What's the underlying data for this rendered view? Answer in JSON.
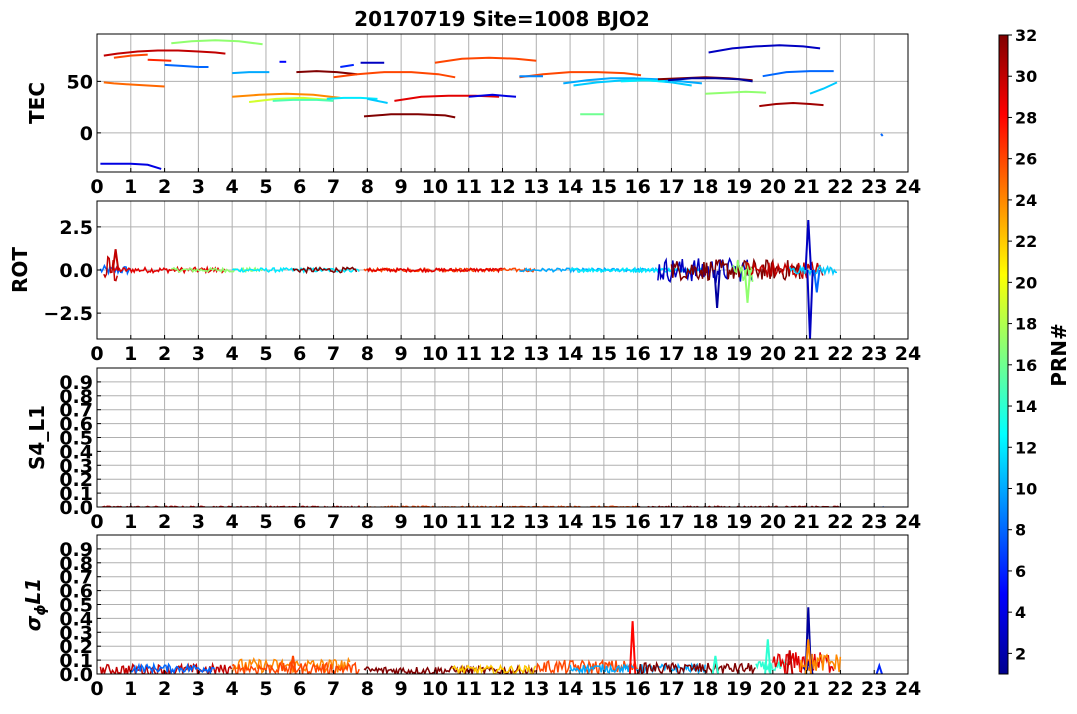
{
  "figure": {
    "title": "20170719 Site=1008 BJO2",
    "colorbar_label": "PRN#",
    "colorbar_range": [
      1,
      32
    ],
    "colorbar_ticks": [
      "2",
      "4",
      "6",
      "8",
      "10",
      "12",
      "14",
      "16",
      "18",
      "20",
      "22",
      "24",
      "26",
      "28",
      "30",
      "32"
    ],
    "colormap": "jet"
  },
  "chart_data": [
    {
      "type": "line",
      "ylabel": "TEC",
      "xlim": [
        0,
        24
      ],
      "ylim": [
        -38,
        96
      ],
      "x_ticks": [
        "0",
        "1",
        "2",
        "3",
        "4",
        "5",
        "6",
        "7",
        "8",
        "9",
        "10",
        "11",
        "12",
        "13",
        "14",
        "15",
        "16",
        "17",
        "18",
        "19",
        "20",
        "21",
        "22",
        "23",
        "24"
      ],
      "y_ticks": [
        {
          "v": 0,
          "label": "0"
        },
        {
          "v": 50,
          "label": "50"
        }
      ],
      "grid": true,
      "series": [
        {
          "prn": 25,
          "x": [
            0.2,
            0.5,
            1.0,
            1.5,
            2.0
          ],
          "y": [
            49,
            48,
            47,
            46,
            45
          ]
        },
        {
          "prn": 4,
          "x": [
            0.1,
            0.5,
            1.0,
            1.5,
            1.9
          ],
          "y": [
            -30,
            -30,
            -30,
            -31,
            -35
          ]
        },
        {
          "prn": 30,
          "x": [
            0.2,
            0.6,
            1.2,
            1.8,
            2.4,
            3.0,
            3.5,
            3.8
          ],
          "y": [
            75,
            77,
            79,
            80,
            80,
            79,
            78,
            77
          ]
        },
        {
          "prn": 26,
          "x": [
            0.5,
            1.0,
            1.5
          ],
          "y": [
            73,
            75,
            76
          ]
        },
        {
          "prn": 27,
          "x": [
            1.5,
            2.2
          ],
          "y": [
            71,
            70
          ]
        },
        {
          "prn": 8,
          "x": [
            2.0,
            2.5,
            3.0,
            3.3
          ],
          "y": [
            66,
            65,
            64,
            64
          ]
        },
        {
          "prn": 17,
          "x": [
            2.2,
            2.8,
            3.5,
            4.2,
            4.9
          ],
          "y": [
            87,
            89,
            90,
            89,
            86
          ]
        },
        {
          "prn": 10,
          "x": [
            4.0,
            4.5,
            5.1
          ],
          "y": [
            58,
            59,
            59
          ]
        },
        {
          "prn": 5,
          "x": [
            5.4,
            5.6
          ],
          "y": [
            69,
            69
          ]
        },
        {
          "prn": 24,
          "x": [
            4.0,
            4.8,
            5.6,
            6.4,
            7.2
          ],
          "y": [
            35,
            37,
            38,
            37,
            34
          ]
        },
        {
          "prn": 19,
          "x": [
            4.5,
            5.3,
            6.1,
            6.9
          ],
          "y": [
            30,
            33,
            34,
            32
          ]
        },
        {
          "prn": 15,
          "x": [
            5.2,
            5.8,
            6.5,
            7.0
          ],
          "y": [
            31,
            32,
            32,
            31
          ]
        },
        {
          "prn": 32,
          "x": [
            5.9,
            6.5,
            7.1,
            7.7
          ],
          "y": [
            59,
            60,
            59,
            57
          ]
        },
        {
          "prn": 6,
          "x": [
            7.2,
            7.6
          ],
          "y": [
            64,
            66
          ]
        },
        {
          "prn": 3,
          "x": [
            7.8,
            8.5
          ],
          "y": [
            68,
            68
          ]
        },
        {
          "prn": 12,
          "x": [
            6.8,
            7.3,
            7.8,
            8.3
          ],
          "y": [
            33,
            34,
            34,
            33
          ]
        },
        {
          "prn": 11,
          "x": [
            8.0,
            8.6
          ],
          "y": [
            33,
            29
          ]
        },
        {
          "prn": 26,
          "x": [
            7.0,
            7.7,
            8.5,
            9.3,
            10.1,
            10.6
          ],
          "y": [
            54,
            57,
            59,
            59,
            57,
            54
          ]
        },
        {
          "prn": 32,
          "x": [
            7.9,
            8.7,
            9.5,
            10.3,
            10.6
          ],
          "y": [
            16,
            18,
            18,
            17,
            15
          ]
        },
        {
          "prn": 29,
          "x": [
            8.8,
            9.6,
            10.4,
            11.2,
            11.9
          ],
          "y": [
            31,
            35,
            36,
            36,
            35
          ]
        },
        {
          "prn": 4,
          "x": [
            11.0,
            11.7,
            12.4
          ],
          "y": [
            35,
            37,
            35
          ]
        },
        {
          "prn": 26,
          "x": [
            10.0,
            10.8,
            11.6,
            12.4,
            13.0
          ],
          "y": [
            68,
            72,
            73,
            72,
            70
          ]
        },
        {
          "prn": 26,
          "x": [
            12.5,
            13.2,
            14.0,
            14.8,
            15.6,
            16.1
          ],
          "y": [
            54,
            57,
            59,
            59,
            58,
            56
          ]
        },
        {
          "prn": 9,
          "x": [
            12.5,
            13.2
          ],
          "y": [
            55,
            55
          ]
        },
        {
          "prn": 10,
          "x": [
            13.8,
            14.5,
            15.2,
            15.9,
            16.6,
            17.3,
            17.9
          ],
          "y": [
            48,
            51,
            53,
            53,
            52,
            50,
            48
          ]
        },
        {
          "prn": 11,
          "x": [
            14.1,
            14.8,
            15.6,
            16.3,
            17.0,
            17.6
          ],
          "y": [
            46,
            49,
            51,
            51,
            49,
            46
          ]
        },
        {
          "prn": 16,
          "x": [
            14.3,
            15.0
          ],
          "y": [
            18,
            18
          ]
        },
        {
          "prn": 12,
          "x": [
            15.5,
            16.2,
            16.8
          ],
          "y": [
            50,
            51,
            50
          ]
        },
        {
          "prn": 32,
          "x": [
            16.6,
            17.3,
            18.0,
            18.7,
            19.4
          ],
          "y": [
            52,
            53,
            54,
            53,
            51
          ]
        },
        {
          "prn": 2,
          "x": [
            16.9,
            17.6,
            18.3,
            19.0,
            19.4
          ],
          "y": [
            51,
            53,
            53,
            52,
            50
          ]
        },
        {
          "prn": 17,
          "x": [
            18.0,
            18.6,
            19.2,
            19.8
          ],
          "y": [
            38,
            39,
            40,
            39
          ]
        },
        {
          "prn": 3,
          "x": [
            18.1,
            18.8,
            19.5,
            20.2,
            20.9,
            21.4
          ],
          "y": [
            78,
            82,
            84,
            85,
            84,
            82
          ]
        },
        {
          "prn": 31,
          "x": [
            19.6,
            20.1,
            20.6,
            21.1,
            21.5
          ],
          "y": [
            26,
            28,
            29,
            28,
            27
          ]
        },
        {
          "prn": 8,
          "x": [
            19.7,
            20.4,
            21.1,
            21.8
          ],
          "y": [
            55,
            59,
            60,
            60
          ]
        },
        {
          "prn": 11,
          "x": [
            21.1,
            21.5,
            21.9
          ],
          "y": [
            38,
            43,
            49
          ]
        },
        {
          "prn": 8,
          "x": [
            23.2,
            23.25
          ],
          "y": [
            -1,
            -3
          ]
        }
      ]
    },
    {
      "type": "line",
      "ylabel": "ROT",
      "xlim": [
        0,
        24
      ],
      "ylim": [
        -4.0,
        4.0
      ],
      "x_ticks": [
        "0",
        "1",
        "2",
        "3",
        "4",
        "5",
        "6",
        "7",
        "8",
        "9",
        "10",
        "11",
        "12",
        "13",
        "14",
        "15",
        "16",
        "17",
        "18",
        "19",
        "20",
        "21",
        "22",
        "23",
        "24"
      ],
      "y_ticks": [
        {
          "v": -2.5,
          "label": "−2.5"
        },
        {
          "v": 0,
          "label": "0.0"
        },
        {
          "v": 2.5,
          "label": "2.5"
        }
      ],
      "grid": true,
      "noise": [
        {
          "prn": 8,
          "x0": 0.1,
          "x1": 1.0,
          "amp": 0.25
        },
        {
          "prn": 30,
          "x0": 0.2,
          "x1": 0.6,
          "amp": 0.9
        },
        {
          "prn": 29,
          "x0": 0.5,
          "x1": 3.8,
          "amp": 0.15
        },
        {
          "prn": 17,
          "x0": 2.2,
          "x1": 4.9,
          "amp": 0.12
        },
        {
          "prn": 12,
          "x0": 4.0,
          "x1": 7.8,
          "amp": 0.12
        },
        {
          "prn": 32,
          "x0": 5.8,
          "x1": 7.7,
          "amp": 0.15
        },
        {
          "prn": 26,
          "x0": 7.9,
          "x1": 13.0,
          "amp": 0.1
        },
        {
          "prn": 29,
          "x0": 8.0,
          "x1": 12.0,
          "amp": 0.1
        },
        {
          "prn": 10,
          "x0": 12.5,
          "x1": 17.9,
          "amp": 0.1
        },
        {
          "prn": 12,
          "x0": 14.0,
          "x1": 18.0,
          "amp": 0.12
        },
        {
          "prn": 3,
          "x0": 16.6,
          "x1": 19.4,
          "amp": 0.7
        },
        {
          "prn": 32,
          "x0": 17.0,
          "x1": 20.8,
          "amp": 0.6
        },
        {
          "prn": 17,
          "x0": 18.8,
          "x1": 19.4,
          "amp": 0.7
        },
        {
          "prn": 30,
          "x0": 19.2,
          "x1": 21.5,
          "amp": 0.5
        },
        {
          "prn": 11,
          "x0": 20.5,
          "x1": 21.9,
          "amp": 0.25
        }
      ],
      "spikes": [
        {
          "prn": 30,
          "x": 0.55,
          "y": 1.2
        },
        {
          "prn": 2,
          "x": 18.35,
          "y": -2.2
        },
        {
          "prn": 17,
          "x": 19.25,
          "y": -1.9
        },
        {
          "prn": 3,
          "x": 21.05,
          "y": 2.9
        },
        {
          "prn": 3,
          "x": 21.1,
          "y": -4.0
        },
        {
          "prn": 8,
          "x": 21.3,
          "y": -1.3
        }
      ]
    },
    {
      "type": "line",
      "ylabel": "S4_L1",
      "xlim": [
        0,
        24
      ],
      "ylim": [
        0.0,
        1.0
      ],
      "x_ticks": [
        "0",
        "1",
        "2",
        "3",
        "4",
        "5",
        "6",
        "7",
        "8",
        "9",
        "10",
        "11",
        "12",
        "13",
        "14",
        "15",
        "16",
        "17",
        "18",
        "19",
        "20",
        "21",
        "22",
        "23",
        "24"
      ],
      "y_ticks": [
        {
          "v": 0.0,
          "label": "0.0"
        },
        {
          "v": 0.1,
          "label": "0.1"
        },
        {
          "v": 0.2,
          "label": "0.2"
        },
        {
          "v": 0.3,
          "label": "0.3"
        },
        {
          "v": 0.4,
          "label": "0.4"
        },
        {
          "v": 0.5,
          "label": "0.5"
        },
        {
          "v": 0.6,
          "label": "0.6"
        },
        {
          "v": 0.7,
          "label": "0.7"
        },
        {
          "v": 0.8,
          "label": "0.8"
        },
        {
          "v": 0.9,
          "label": "0.9"
        }
      ],
      "grid": true,
      "noise": [
        {
          "prn": 30,
          "x0": 0.1,
          "x1": 7.8,
          "amp": 0.005
        },
        {
          "prn": 26,
          "x0": 7.9,
          "x1": 16.0,
          "amp": 0.005
        },
        {
          "prn": 31,
          "x0": 16.0,
          "x1": 22.0,
          "amp": 0.005
        },
        {
          "prn": 8,
          "x0": 23.2,
          "x1": 23.3,
          "amp": 0.005
        }
      ]
    },
    {
      "type": "line",
      "ylabel": "σϕL1",
      "xlim": [
        0,
        24
      ],
      "ylim": [
        0.0,
        1.0
      ],
      "x_ticks": [
        "0",
        "1",
        "2",
        "3",
        "4",
        "5",
        "6",
        "7",
        "8",
        "9",
        "10",
        "11",
        "12",
        "13",
        "14",
        "15",
        "16",
        "17",
        "18",
        "19",
        "20",
        "21",
        "22",
        "23",
        "24"
      ],
      "y_ticks": [
        {
          "v": 0.0,
          "label": "0.0"
        },
        {
          "v": 0.1,
          "label": "0.1"
        },
        {
          "v": 0.2,
          "label": "0.2"
        },
        {
          "v": 0.3,
          "label": "0.3"
        },
        {
          "v": 0.4,
          "label": "0.4"
        },
        {
          "v": 0.5,
          "label": "0.5"
        },
        {
          "v": 0.6,
          "label": "0.6"
        },
        {
          "v": 0.7,
          "label": "0.7"
        },
        {
          "v": 0.8,
          "label": "0.8"
        },
        {
          "v": 0.9,
          "label": "0.9"
        }
      ],
      "grid": true,
      "noise": [
        {
          "prn": 30,
          "x0": 0.1,
          "x1": 4.0,
          "amp": 0.04,
          "base": 0.03
        },
        {
          "prn": 8,
          "x0": 1.0,
          "x1": 3.5,
          "amp": 0.03,
          "base": 0.04
        },
        {
          "prn": 24,
          "x0": 4.0,
          "x1": 7.5,
          "amp": 0.05,
          "base": 0.06
        },
        {
          "prn": 26,
          "x0": 4.0,
          "x1": 7.8,
          "amp": 0.04,
          "base": 0.04
        },
        {
          "prn": 32,
          "x0": 7.9,
          "x1": 13.0,
          "amp": 0.03,
          "base": 0.025
        },
        {
          "prn": 22,
          "x0": 10.5,
          "x1": 13.0,
          "amp": 0.03,
          "base": 0.03
        },
        {
          "prn": 26,
          "x0": 13.0,
          "x1": 16.0,
          "amp": 0.05,
          "base": 0.05
        },
        {
          "prn": 10,
          "x0": 14.0,
          "x1": 18.0,
          "amp": 0.03,
          "base": 0.04
        },
        {
          "prn": 32,
          "x0": 16.0,
          "x1": 19.5,
          "amp": 0.04,
          "base": 0.04
        },
        {
          "prn": 14,
          "x0": 19.5,
          "x1": 20.5,
          "amp": 0.04,
          "base": 0.05
        },
        {
          "prn": 29,
          "x0": 20.0,
          "x1": 21.8,
          "amp": 0.08,
          "base": 0.08
        },
        {
          "prn": 24,
          "x0": 20.8,
          "x1": 22.0,
          "amp": 0.07,
          "base": 0.08
        },
        {
          "prn": 2,
          "x0": 20.9,
          "x1": 21.2,
          "amp": 0.06,
          "base": 0.05
        }
      ],
      "spikes": [
        {
          "prn": 28,
          "x": 15.85,
          "y": 0.38
        },
        {
          "prn": 2,
          "x": 21.05,
          "y": 0.48
        },
        {
          "prn": 14,
          "x": 19.85,
          "y": 0.25
        },
        {
          "prn": 14,
          "x": 18.3,
          "y": 0.13
        },
        {
          "prn": 24,
          "x": 21.05,
          "y": 0.25
        },
        {
          "prn": 30,
          "x": 20.5,
          "y": 0.17
        },
        {
          "prn": 26,
          "x": 5.8,
          "y": 0.13
        },
        {
          "prn": 6,
          "x": 23.15,
          "y": 0.06
        }
      ]
    }
  ]
}
